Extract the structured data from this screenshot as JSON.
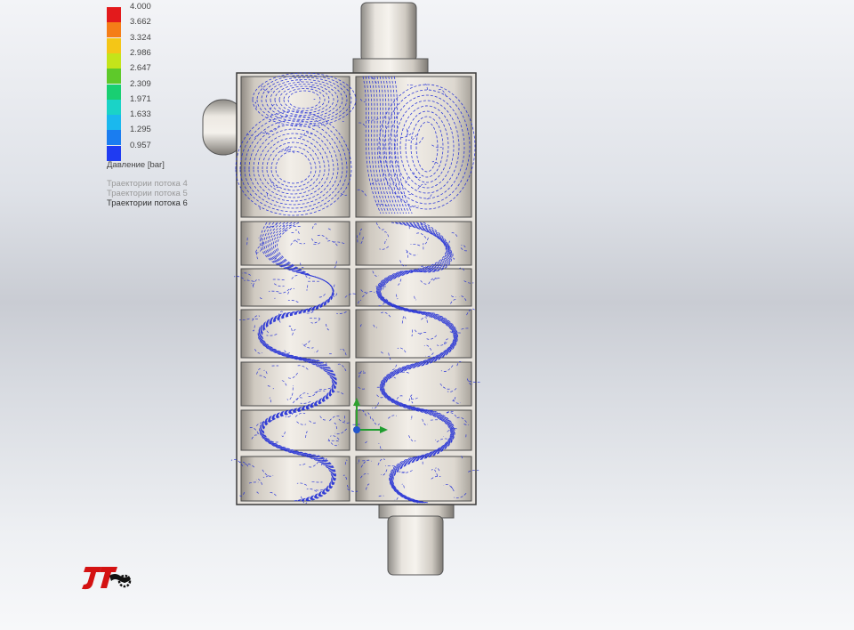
{
  "legend": {
    "values": [
      "4.000",
      "3.662",
      "3.324",
      "2.986",
      "2.647",
      "2.309",
      "1.971",
      "1.633",
      "1.295",
      "0.957"
    ],
    "colors": [
      "#e31a1c",
      "#f57d17",
      "#f4c617",
      "#c4e41a",
      "#5ec92a",
      "#19cf72",
      "#1ad3c7",
      "#1ab8ee",
      "#1a7df0",
      "#1f3bf2"
    ],
    "unit": "Давление [bar]"
  },
  "trajectories": [
    {
      "label": "Траектории потока 4",
      "color": "#9a9a9a"
    },
    {
      "label": "Траектории потока 5",
      "color": "#9a9a9a"
    },
    {
      "label": "Траектории потока 6",
      "color": "#333333"
    }
  ],
  "colors": {
    "streamline": "#1e2bd6",
    "body_outline": "#3b3b3b",
    "axis_y": "#2fa02f",
    "axis_x": "#1f9d2f"
  }
}
